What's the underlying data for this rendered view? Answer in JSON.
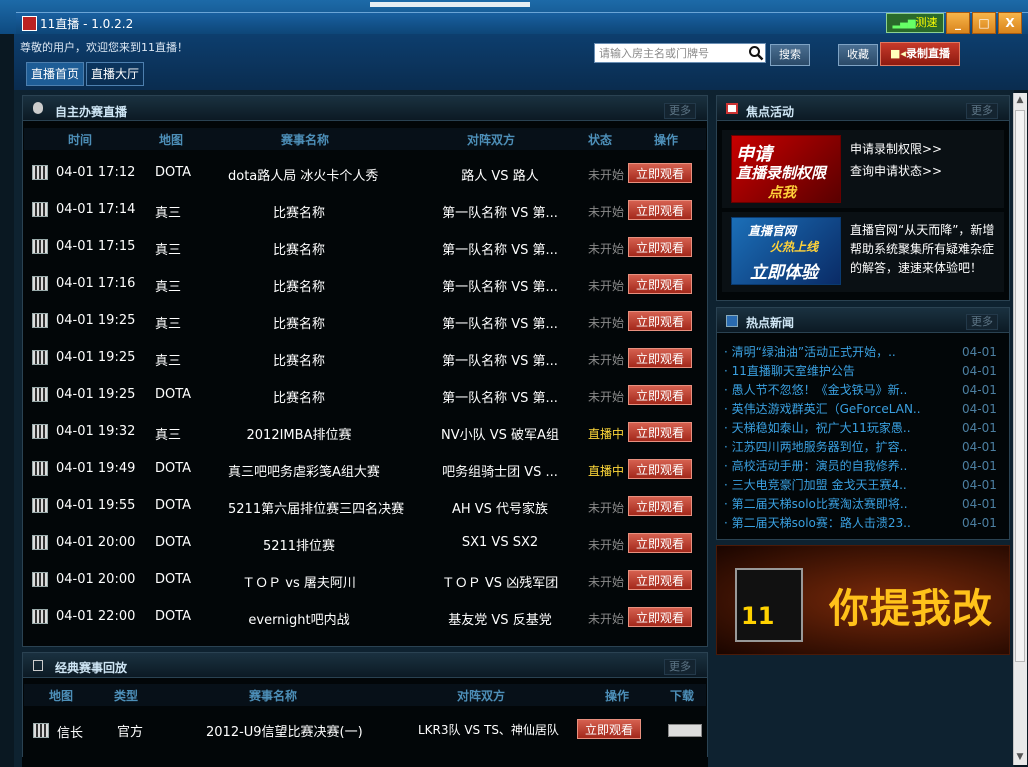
{
  "window": {
    "title": "11直播 - 1.0.2.2",
    "net_label": "测速",
    "minimize": "_",
    "maximize": "□",
    "close": "X"
  },
  "header": {
    "welcome": "尊敬的用户，欢迎您来到11直播！",
    "tabs": [
      {
        "label": "直播首页"
      },
      {
        "label": "直播大厅"
      }
    ],
    "search_placeholder": "请输入房主名或门牌号",
    "search_button": "搜索",
    "favorites_button": "收藏",
    "record_button": "录制直播"
  },
  "self_live": {
    "title": "自主办赛直播",
    "more": "更多",
    "columns": [
      "时间",
      "地图",
      "赛事名称",
      "对阵双方",
      "状态",
      "操作"
    ],
    "rows": [
      {
        "time": "04-01 17:12",
        "map": "DOTA",
        "name": "dota路人局 冰火卡个人秀",
        "teams": "路人 VS 路人",
        "status": "未开始",
        "action": "立即观看"
      },
      {
        "time": "04-01 17:14",
        "map": "真三",
        "name": "比赛名称",
        "teams": "第一队名称 VS 第...",
        "status": "未开始",
        "action": "立即观看"
      },
      {
        "time": "04-01 17:15",
        "map": "真三",
        "name": "比赛名称",
        "teams": "第一队名称 VS 第...",
        "status": "未开始",
        "action": "立即观看"
      },
      {
        "time": "04-01 17:16",
        "map": "真三",
        "name": "比赛名称",
        "teams": "第一队名称 VS 第...",
        "status": "未开始",
        "action": "立即观看"
      },
      {
        "time": "04-01 19:25",
        "map": "真三",
        "name": "比赛名称",
        "teams": "第一队名称 VS 第...",
        "status": "未开始",
        "action": "立即观看"
      },
      {
        "time": "04-01 19:25",
        "map": "真三",
        "name": "比赛名称",
        "teams": "第一队名称 VS 第...",
        "status": "未开始",
        "action": "立即观看"
      },
      {
        "time": "04-01 19:25",
        "map": "DOTA",
        "name": "比赛名称",
        "teams": "第一队名称 VS 第...",
        "status": "未开始",
        "action": "立即观看"
      },
      {
        "time": "04-01 19:32",
        "map": "真三",
        "name": "2012IMBA排位赛",
        "teams": "NV小队 VS 破军A组",
        "status": "直播中",
        "action": "立即观看"
      },
      {
        "time": "04-01 19:49",
        "map": "DOTA",
        "name": "真三吧吧务虐彩笺A组大赛",
        "teams": "吧务组骑士团 VS ...",
        "status": "直播中",
        "action": "立即观看"
      },
      {
        "time": "04-01 19:55",
        "map": "DOTA",
        "name": "5211第六届排位赛三四名决赛",
        "teams": "AH VS 代号家族",
        "status": "未开始",
        "action": "立即观看"
      },
      {
        "time": "04-01 20:00",
        "map": "DOTA",
        "name": "5211排位赛",
        "teams": "SX1 VS SX2",
        "status": "未开始",
        "action": "立即观看"
      },
      {
        "time": "04-01 20:00",
        "map": "DOTA",
        "name": "ＴＯＰ vs 屠夫阿川",
        "teams": "ＴＯＰ VS 凶残军团",
        "status": "未开始",
        "action": "立即观看"
      },
      {
        "time": "04-01 22:00",
        "map": "DOTA",
        "name": "evernight吧内战",
        "teams": "基友党 VS 反基党",
        "status": "未开始",
        "action": "立即观看"
      }
    ]
  },
  "replay": {
    "title": "经典赛事回放",
    "more": "更多",
    "columns": [
      "地图",
      "类型",
      "赛事名称",
      "对阵双方",
      "操作",
      "下载"
    ],
    "rows": [
      {
        "map": "信长",
        "type": "官方",
        "name": "2012-U9信望比赛决赛(一)",
        "teams": "LKR3队 VS TS、神仙居队",
        "action": "立即观看"
      }
    ]
  },
  "focus": {
    "title": "焦点活动",
    "more": "更多",
    "items": [
      {
        "banner": [
          "申请",
          "直播录制权限",
          "点我"
        ],
        "links": [
          "申请录制权限>>",
          "查询申请状态>>"
        ]
      },
      {
        "banner": [
          "直播官网",
          "火热上线",
          "立即体验"
        ],
        "text": "直播官网“从天而降”，新增帮助系统聚集所有疑难杂症的解答，速速来体验吧！"
      }
    ]
  },
  "hot_news": {
    "title": "热点新闻",
    "more": "更多",
    "items": [
      {
        "title": "· 清明“绿油油”活动正式开始，..",
        "date": "04-01"
      },
      {
        "title": "· 11直播聊天室维护公告",
        "date": "04-01"
      },
      {
        "title": "· 愚人节不忽悠！《金戈铁马》新..",
        "date": "04-01"
      },
      {
        "title": "· 英伟达游戏群英汇（GeForceLAN..",
        "date": "04-01"
      },
      {
        "title": "· 天梯稳如泰山，祝广大11玩家愚..",
        "date": "04-01"
      },
      {
        "title": "· 江苏四川两地服务器到位，扩容..",
        "date": "04-01"
      },
      {
        "title": "· 高校活动手册：演员的自我修养..",
        "date": "04-01"
      },
      {
        "title": "· 三大电竞豪门加盟 金戈天王赛4..",
        "date": "04-01"
      },
      {
        "title": "· 第二届天梯solo比赛淘汰赛即将..",
        "date": "04-01"
      },
      {
        "title": "· 第二届天梯solo赛：路人击溃23..",
        "date": "04-01"
      }
    ]
  },
  "ad": {
    "logo": "11",
    "slogan": "你提我改"
  }
}
